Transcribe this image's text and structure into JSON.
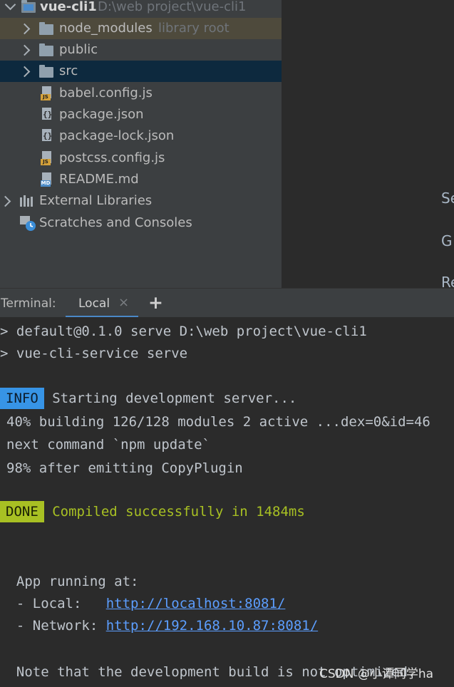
{
  "project_tree": {
    "root": {
      "name": "vue-cli1",
      "path": "D:\\web project\\vue-cli1"
    },
    "items": [
      {
        "label": "node_modules",
        "suffix": "library root"
      },
      {
        "label": "public"
      },
      {
        "label": "src"
      },
      {
        "label": "babel.config.js",
        "icon": "js-file-icon",
        "badge": "JS"
      },
      {
        "label": "package.json",
        "icon": "json-file-icon"
      },
      {
        "label": "package-lock.json",
        "icon": "json-file-icon"
      },
      {
        "label": "postcss.config.js",
        "icon": "js-file-icon",
        "badge": "JS"
      },
      {
        "label": "README.md",
        "icon": "markdown-file-icon",
        "badge": "MD"
      }
    ],
    "external_libraries": "External Libraries",
    "scratches": "Scratches and Consoles"
  },
  "right_pane": {
    "chars": [
      "Se",
      "G",
      "Re"
    ]
  },
  "terminal": {
    "title": "Terminal:",
    "tab": "Local",
    "close": "×",
    "add": "+",
    "lines": {
      "cmd1": "> default@0.1.0 serve D:\\web project\\vue-cli1",
      "cmd2": "> vue-cli-service serve",
      "info_badge": "INFO",
      "info_text": " Starting development server...",
      "build": "40% building 126/128 modules 2 active ...dex=0&id=46",
      "next": "next command `npm update`",
      "after": "98% after emitting CopyPlugin",
      "done_badge": "DONE",
      "done_text": " Compiled successfully in 1484ms",
      "running": "  App running at:",
      "local_label": "  - Local:   ",
      "local_url": "http://localhost:8081/",
      "network_label": "  - Network: ",
      "network_url": "http://192.168.10.87:8081/",
      "note": "  Note that the development build is not optimized."
    }
  },
  "watermark": "CSDN @小谭同学ha"
}
